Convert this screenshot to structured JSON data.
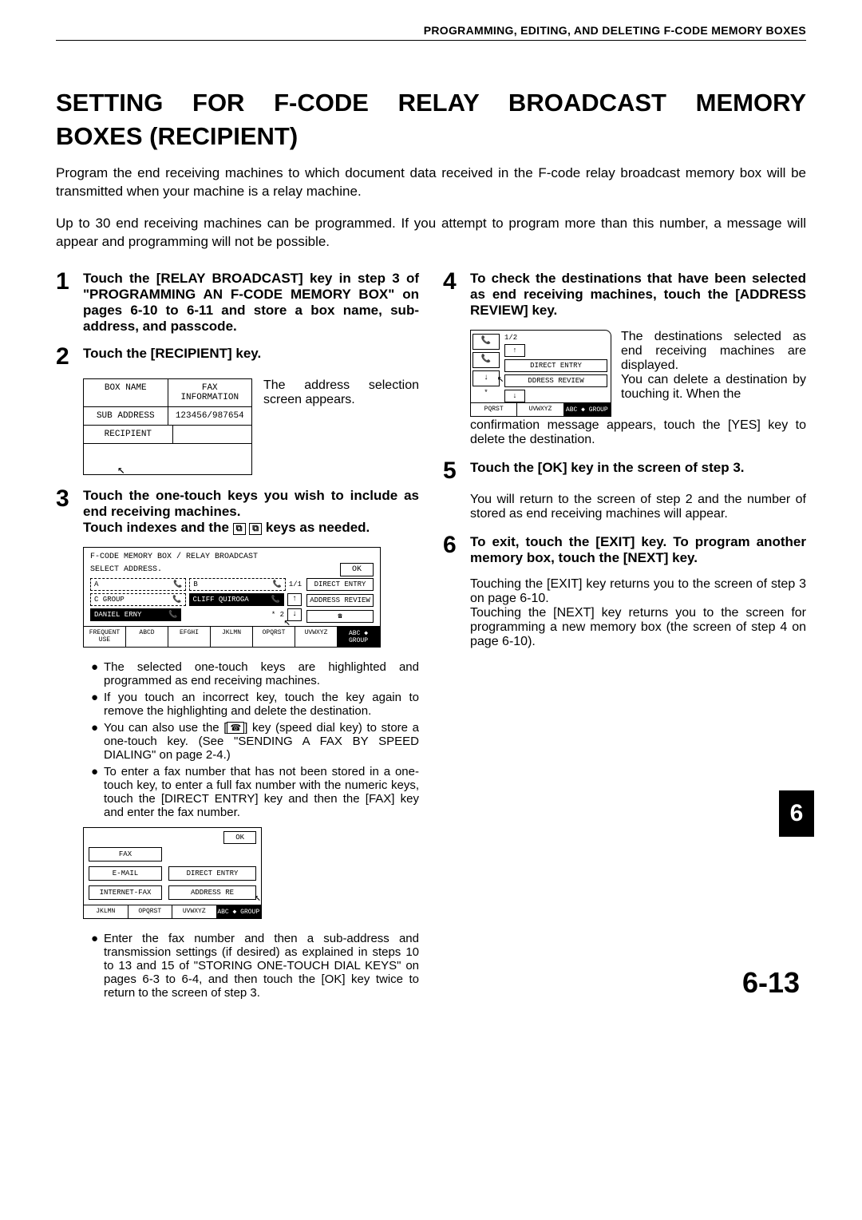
{
  "header": "PROGRAMMING, EDITING, AND DELETING F-CODE MEMORY BOXES",
  "title_l1": "SETTING FOR F-CODE RELAY BROADCAST MEMORY",
  "title_l2": "BOXES (RECIPIENT)",
  "intro1": "Program the end receiving machines to which document data received in the F-code relay broadcast memory box will be transmitted when your machine is a relay machine.",
  "intro2": "Up to 30 end receiving machines can be programmed. If you attempt to program more than this number, a message will appear and programming will not be possible.",
  "s1": {
    "num": "1",
    "text": "Touch the [RELAY BROADCAST] key in step 3 of \"PROGRAMMING AN F-CODE MEMORY BOX\" on pages 6-10 to 6-11 and store a box name, sub-address, and passcode."
  },
  "s2": {
    "num": "2",
    "text": "Touch the [RECIPIENT] key.",
    "caption": "The address selection screen appears.",
    "ui": {
      "box_name": "BOX NAME",
      "fax_info": "FAX INFORMATION",
      "sub_addr": "SUB ADDRESS",
      "sub_val": "123456/987654",
      "recipient": "RECIPIENT"
    }
  },
  "s3": {
    "num": "3",
    "text_a": "Touch the one-touch keys you wish to include as end receiving machines.",
    "text_b": "Touch indexes and the",
    "text_c": "keys as needed.",
    "ui": {
      "path": "F-CODE MEMORY BOX / RELAY BROADCAST",
      "sel": "SELECT ADDRESS.",
      "ok": "OK",
      "a": "A",
      "b": "B",
      "page": "1/1",
      "direct": "DIRECT ENTRY",
      "c_group": "C GROUP",
      "cliff": "CLIFF QUIROGA",
      "review": "ADDRESS REVIEW",
      "daniel": "DANIEL ERNY",
      "star2": "* 2",
      "tabs": [
        "FREQUENT USE",
        "ABCD",
        "EFGHI",
        "JKLMN",
        "OPQRST",
        "UVWXYZ",
        "ABC ◆ GROUP"
      ]
    },
    "b1": "The selected one-touch keys are highlighted and programmed as end receiving machines.",
    "b2": "If you touch an incorrect key, touch the key again to remove the highlighting and delete the destination.",
    "b3a": "You can also use the [",
    "b3b": "] key (speed dial key) to store a one-touch key. (See \"SENDING A FAX BY SPEED DIALING\" on page 2-4.)",
    "b4": "To enter a fax number that has not been stored in a one-touch key, to enter a full fax number with the numeric keys, touch the [DIRECT ENTRY] key and then the [FAX] key and enter the fax number.",
    "ui2": {
      "ok": "OK",
      "fax": "FAX",
      "email": "E-MAIL",
      "ifax": "INTERNET-FAX",
      "direct": "DIRECT ENTRY",
      "review": "ADDRESS RE",
      "tabs": [
        "JKLMN",
        "OPQRST",
        "UVWXYZ",
        "ABC ◆ GROUP"
      ]
    },
    "b5": "Enter the fax number and then a sub-address and transmission settings (if desired) as explained in steps 10 to 13 and 15 of \"STORING ONE-TOUCH DIAL KEYS\" on pages 6-3 to 6-4, and then touch the [OK] key twice to return to the screen of step 3."
  },
  "s4": {
    "num": "4",
    "text": "To check the destinations that have been selected as end receiving machines, touch the [ADDRESS REVIEW] key.",
    "cap1": "The destinations selected as end receiving machines are displayed.",
    "cap2": "You can delete a destination by touching it. When the",
    "cap_tail": "confirmation message appears, touch the [YES] key to delete the destination.",
    "ui": {
      "page": "1/2",
      "direct": "DIRECT ENTRY",
      "review": "DDRESS REVIEW",
      "star": "*",
      "tabs": [
        "PQRST",
        "UVWXYZ",
        "ABC ◆ GROUP"
      ]
    }
  },
  "s5": {
    "num": "5",
    "text": "Touch the [OK] key in the screen of step 3.",
    "body": "You will return to the screen of step 2 and the number of stored as end receiving machines will appear."
  },
  "s6": {
    "num": "6",
    "text": "To exit, touch the [EXIT] key. To program another memory box, touch the [NEXT] key.",
    "b1": "Touching the [EXIT] key returns you to the screen of step 3 on page 6-10.",
    "b2": "Touching the [NEXT] key returns you to the screen for programming a new memory box (the screen of step 4 on page 6-10)."
  },
  "side_tab": "6",
  "page_num": "6-13"
}
